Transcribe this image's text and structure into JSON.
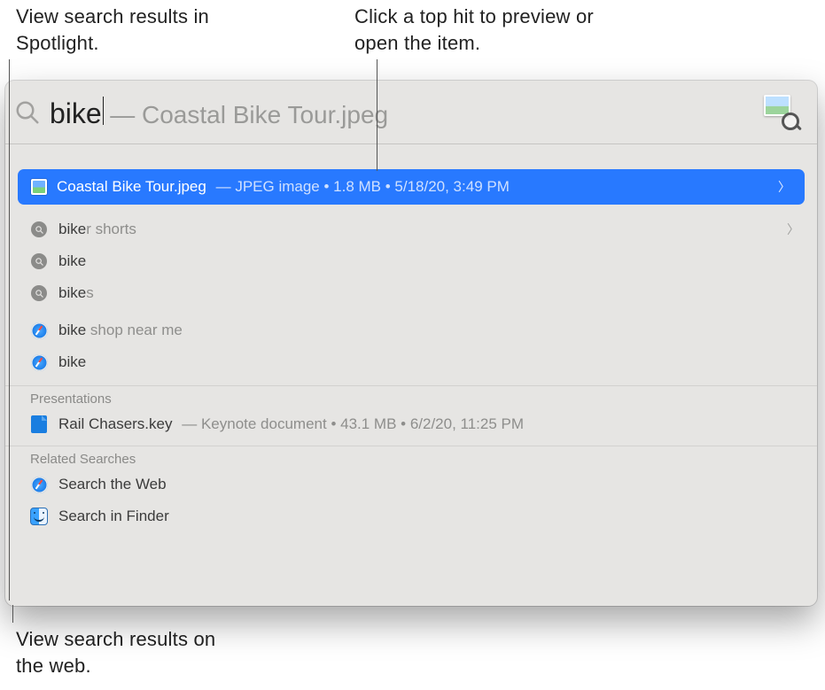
{
  "callouts": {
    "top_left": "View search results in Spotlight.",
    "top_right": "Click a top hit to preview or open the item.",
    "bottom": "View search results on the web."
  },
  "search": {
    "query": "bike",
    "completion_suffix": "— Coastal Bike Tour.jpeg"
  },
  "top_hit": {
    "name": "Coastal Bike Tour.jpeg",
    "meta": "— JPEG image • 1.8 MB • 5/18/20, 3:49 PM"
  },
  "suggestions": [
    {
      "typed": "bike",
      "rest": "r shorts",
      "has_chevron": true
    },
    {
      "typed": "bike",
      "rest": "",
      "has_chevron": false
    },
    {
      "typed": "bike",
      "rest": "s",
      "has_chevron": false
    }
  ],
  "web_suggestions": [
    {
      "typed": "bike",
      "rest": " shop near me"
    },
    {
      "typed": "bike",
      "rest": ""
    }
  ],
  "sections": {
    "presentations_label": "Presentations",
    "related_label": "Related Searches"
  },
  "presentations": [
    {
      "name": "Rail Chasers.key",
      "meta": "— Keynote document • 43.1 MB • 6/2/20, 11:25 PM"
    }
  ],
  "related": [
    {
      "label": "Search the Web",
      "icon": "safari"
    },
    {
      "label": "Search in Finder",
      "icon": "finder"
    }
  ]
}
